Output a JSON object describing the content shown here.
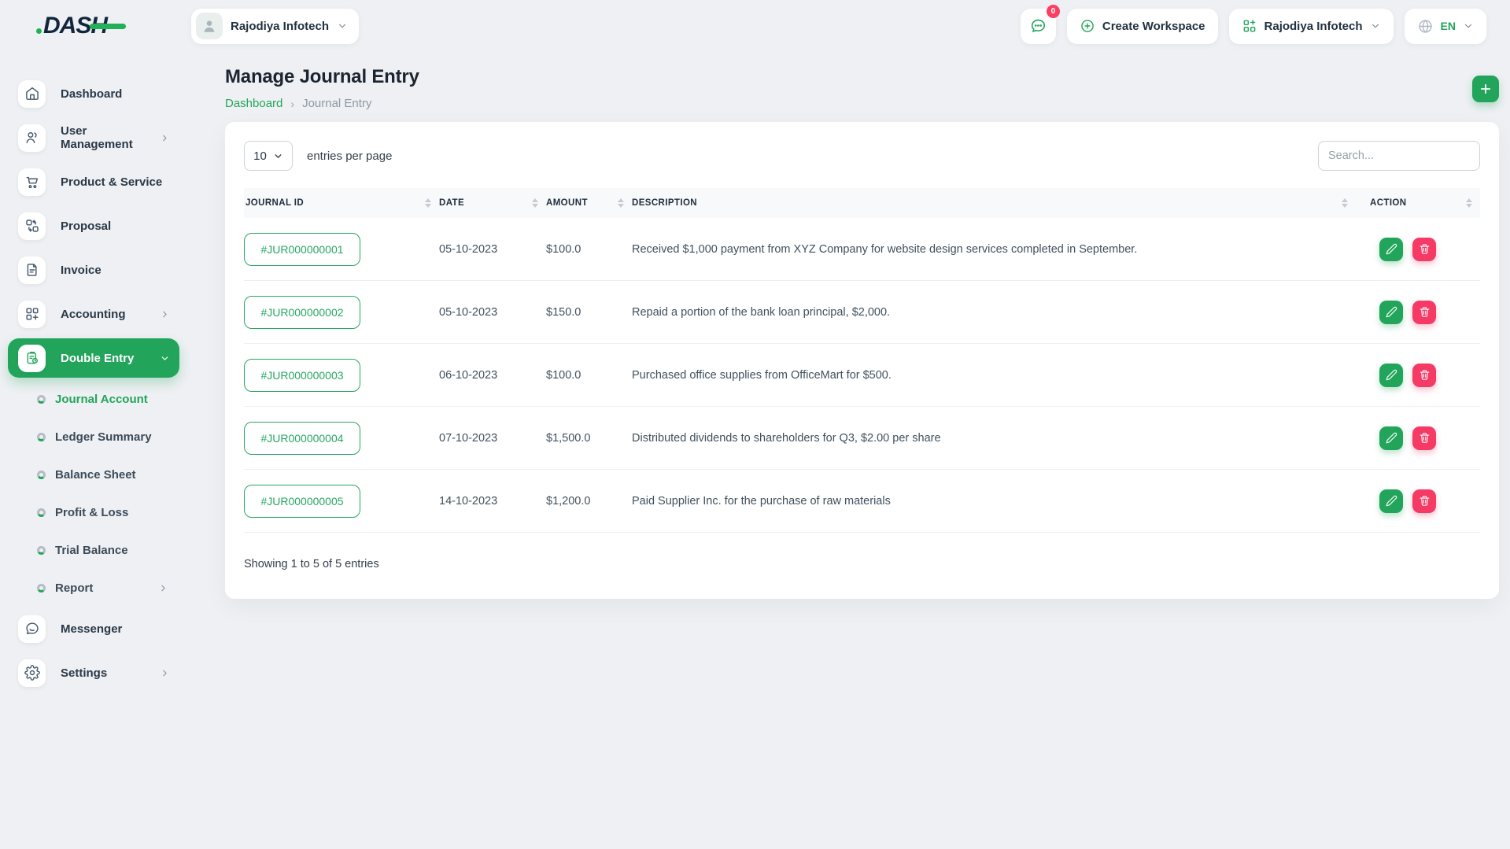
{
  "brand": {
    "logo_text": "DASH"
  },
  "topbar": {
    "workspace": {
      "label": "Rajodiya Infotech"
    },
    "chat_badge": "0",
    "create_workspace_label": "Create Workspace",
    "company": {
      "label": "Rajodiya Infotech"
    },
    "language": {
      "label": "EN"
    }
  },
  "sidebar": {
    "items": [
      {
        "label": "Dashboard"
      },
      {
        "label": "User Management"
      },
      {
        "label": "Product & Service"
      },
      {
        "label": "Proposal"
      },
      {
        "label": "Invoice"
      },
      {
        "label": "Accounting"
      },
      {
        "label": "Double Entry"
      }
    ],
    "double_entry_children": [
      {
        "label": "Journal Account"
      },
      {
        "label": "Ledger Summary"
      },
      {
        "label": "Balance Sheet"
      },
      {
        "label": "Profit & Loss"
      },
      {
        "label": "Trial Balance"
      },
      {
        "label": "Report"
      }
    ],
    "footer_items": [
      {
        "label": "Messenger"
      },
      {
        "label": "Settings"
      }
    ]
  },
  "page": {
    "title": "Manage Journal Entry",
    "breadcrumb": {
      "root": "Dashboard",
      "current": "Journal Entry"
    }
  },
  "controls": {
    "page_size": "10",
    "entries_label": "entries per page",
    "search_placeholder": "Search..."
  },
  "table": {
    "headers": [
      "JOURNAL ID",
      "DATE",
      "AMOUNT",
      "DESCRIPTION",
      "ACTION"
    ],
    "rows": [
      {
        "journal_id": "#JUR000000001",
        "date": "05-10-2023",
        "amount": "$100.0",
        "description": "Received $1,000 payment from XYZ Company for website design services completed in September."
      },
      {
        "journal_id": "#JUR000000002",
        "date": "05-10-2023",
        "amount": "$150.0",
        "description": "Repaid a portion of the bank loan principal, $2,000."
      },
      {
        "journal_id": "#JUR000000003",
        "date": "06-10-2023",
        "amount": "$100.0",
        "description": "Purchased office supplies from OfficeMart for $500."
      },
      {
        "journal_id": "#JUR000000004",
        "date": "07-10-2023",
        "amount": "$1,500.0",
        "description": "Distributed dividends to shareholders for Q3, $2.00 per share"
      },
      {
        "journal_id": "#JUR000000005",
        "date": "14-10-2023",
        "amount": "$1,200.0",
        "description": "Paid Supplier Inc. for the purchase of raw materials"
      }
    ],
    "summary": "Showing 1 to 5 of 5 entries"
  },
  "colors": {
    "primary_green": "#22a55b",
    "danger_pink": "#f53a66",
    "badge_red": "#fd3e63",
    "logo_navy": "#11263c",
    "page_background": "#eef0f3"
  }
}
